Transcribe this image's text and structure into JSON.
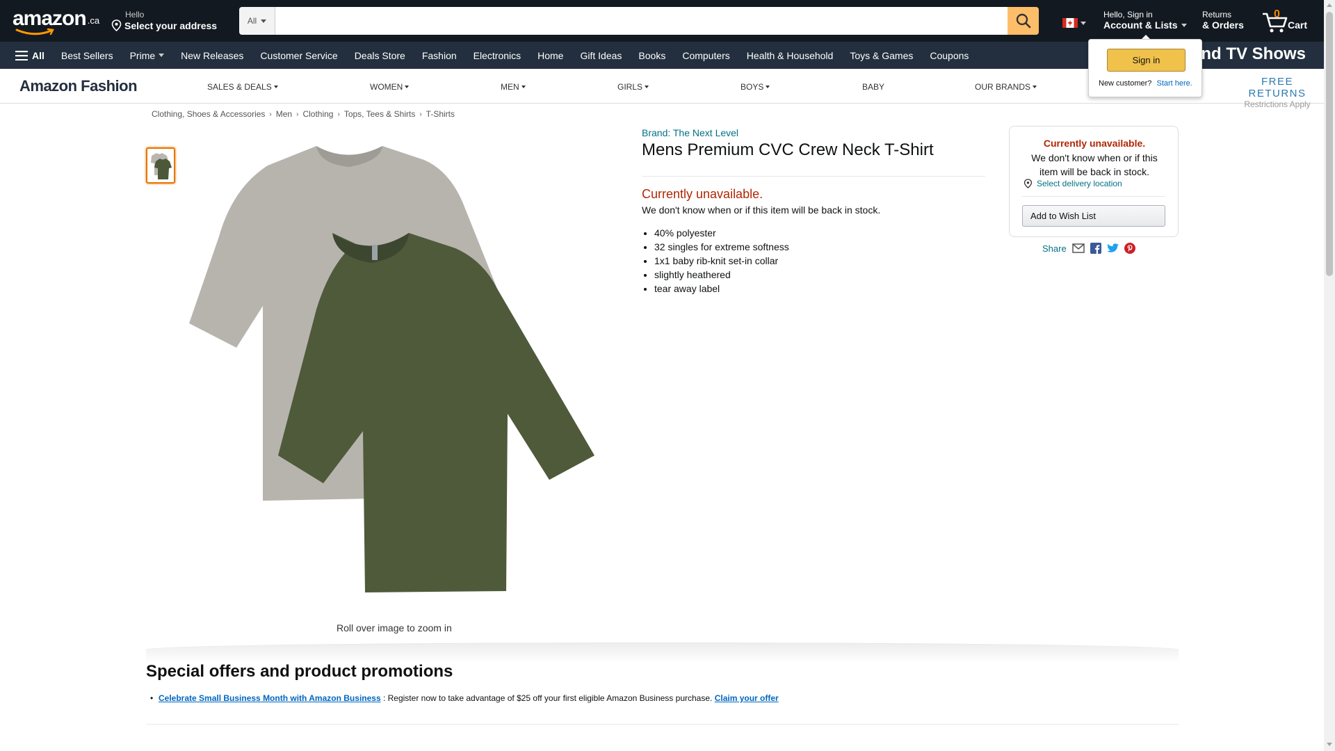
{
  "header": {
    "logo_text": "amazon",
    "logo_suffix": ".ca",
    "address_hello": "Hello",
    "address_label": "Select your address",
    "search_dept": "All",
    "search_placeholder": "",
    "account_hello": "Hello, Sign in",
    "account_label": "Account & Lists",
    "returns_line1": "Returns",
    "returns_line2": "& Orders",
    "cart_count": "0",
    "cart_label": "Cart"
  },
  "nav": {
    "all_label": "All",
    "items": [
      "Best Sellers",
      "Prime",
      "New Releases",
      "Customer Service",
      "Deals Store",
      "Fashion",
      "Electronics",
      "Home",
      "Gift Ideas",
      "Books",
      "Computers",
      "Health & Household",
      "Toys & Games",
      "Coupons"
    ],
    "promo_text": "and TV Shows"
  },
  "signin_flyout": {
    "button": "Sign in",
    "new_customer": "New customer?",
    "start_here": "Start here."
  },
  "fashion_nav": {
    "title": "Amazon Fashion",
    "items": [
      "SALES & DEALS",
      "WOMEN",
      "MEN",
      "GIRLS",
      "BOYS",
      "BABY",
      "OUR BRANDS"
    ],
    "free_returns": "FREE RETURNS",
    "restrictions": "Restrictions Apply"
  },
  "breadcrumb": [
    "Clothing, Shoes & Accessories",
    "Men",
    "Clothing",
    "Tops, Tees & Shirts",
    "T-Shirts"
  ],
  "product": {
    "brand": "Brand: The Next Level",
    "title": "Mens Premium CVC Crew Neck T-Shirt",
    "availability": "Currently unavailable.",
    "availability_note": "We don't know when or if this item will be back in stock.",
    "bullets": [
      "40% polyester",
      "32 singles for extreme softness",
      "1x1 baby rib-knit set-in collar",
      "slightly heathered",
      "tear away label"
    ],
    "zoom_note": "Roll over image to zoom in"
  },
  "buybox": {
    "availability": "Currently unavailable.",
    "note": "We don't know when or if this item will be back in stock.",
    "location_link": "Select delivery location",
    "wishlist_button": "Add to Wish List",
    "share_label": "Share"
  },
  "promotions": {
    "heading": "Special offers and product promotions",
    "link": "Celebrate Small Business Month with Amazon Business",
    "text": " : Register now to take advantage of $25 off your first eligible Amazon Business purchase. ",
    "cta": "Claim your offer"
  },
  "colors": {
    "nav_top": "#131921",
    "nav_main": "#232f3e",
    "accent": "#febd69",
    "link": "#007185",
    "unavailable": "#b12704"
  }
}
